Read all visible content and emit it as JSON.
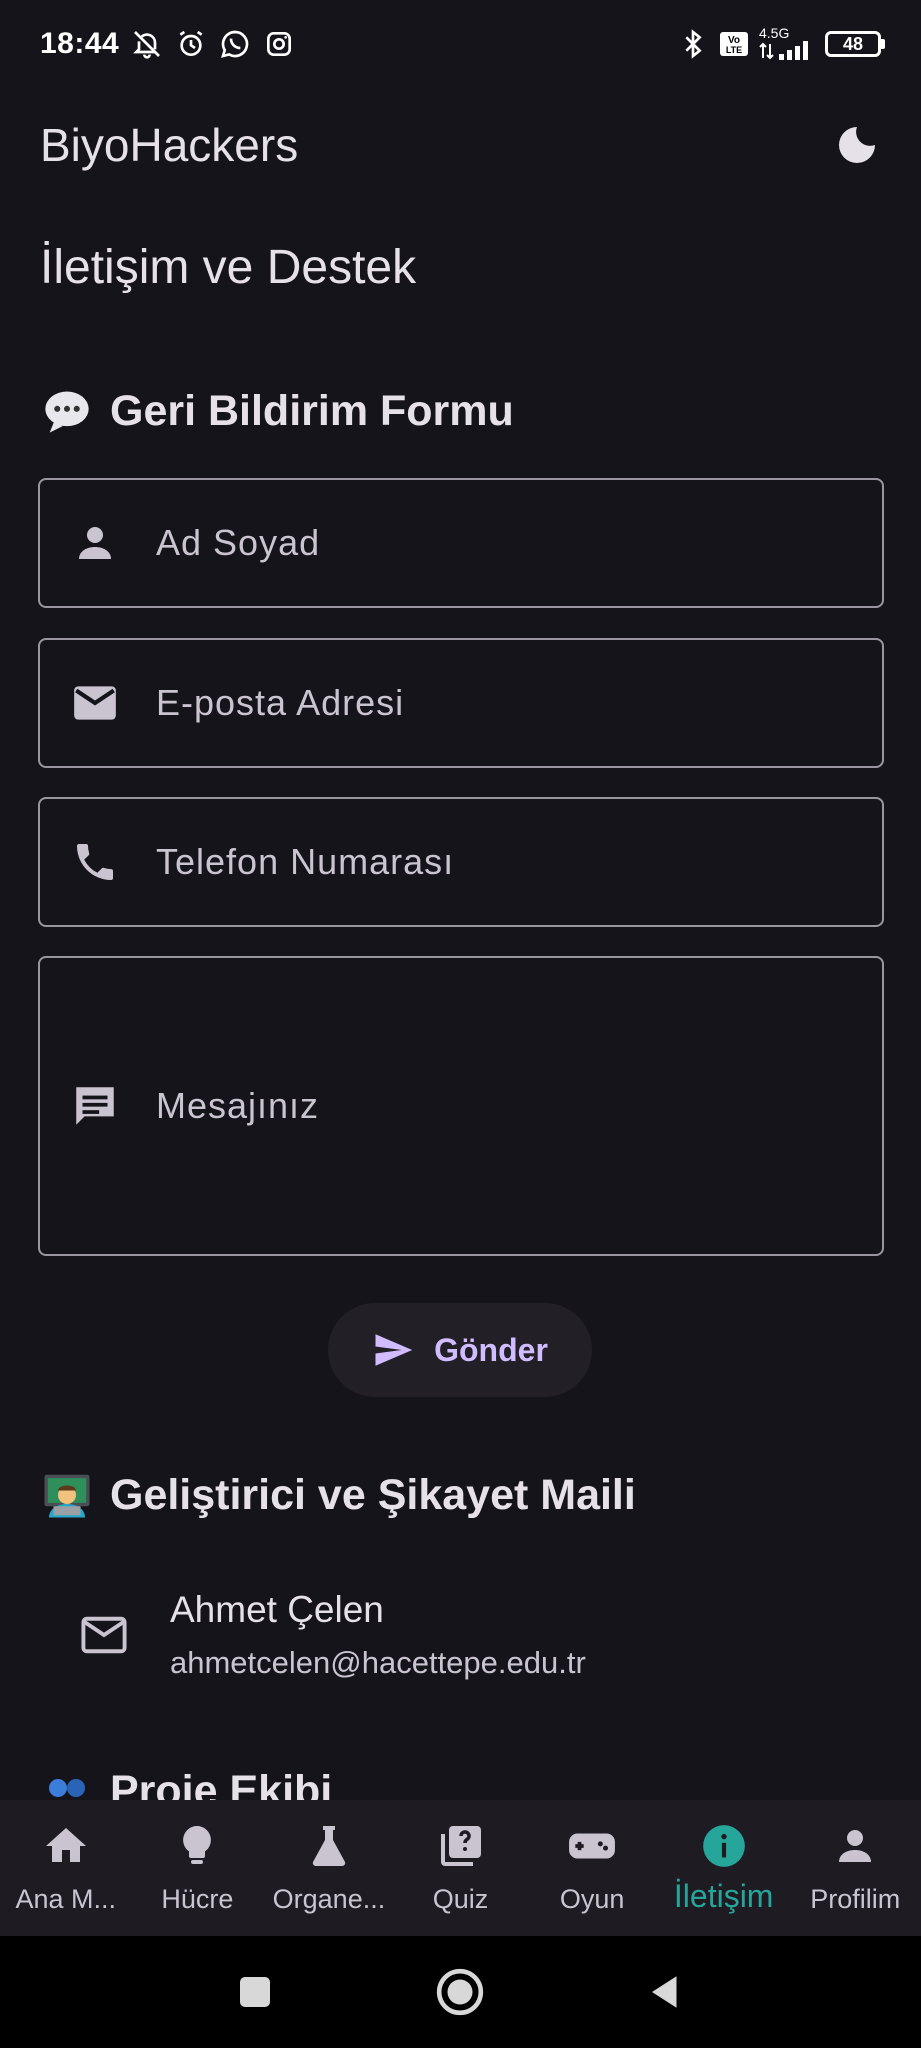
{
  "status_bar": {
    "time": "18:44",
    "network": "4.5G",
    "volte": "Vo LTE",
    "battery": "48"
  },
  "app_bar": {
    "title": "BiyoHackers"
  },
  "page": {
    "title": "İletişim ve Destek"
  },
  "feedback": {
    "heading": "Geri Bildirim Formu",
    "fields": {
      "name_placeholder": "Ad Soyad",
      "email_placeholder": "E-posta Adresi",
      "phone_placeholder": "Telefon Numarası",
      "message_placeholder": "Mesajınız"
    },
    "send_label": "Gönder"
  },
  "developer": {
    "heading": "Geliştirici ve Şikayet Maili",
    "name": "Ahmet Çelen",
    "email": "ahmetcelen@hacettepe.edu.tr"
  },
  "team": {
    "heading": "Proje Ekibi"
  },
  "bottom_nav": {
    "items": [
      {
        "label": "Ana M...",
        "icon": "home-icon"
      },
      {
        "label": "Hücre",
        "icon": "lightbulb-icon"
      },
      {
        "label": "Organe...",
        "icon": "flask-icon"
      },
      {
        "label": "Quiz",
        "icon": "quiz-icon"
      },
      {
        "label": "Oyun",
        "icon": "gamepad-icon"
      },
      {
        "label": "İletişim",
        "icon": "info-icon"
      },
      {
        "label": "Profilim",
        "icon": "person-icon"
      }
    ],
    "active_index": 5
  },
  "colors": {
    "background": "#16141b",
    "accent": "#d0bcff",
    "active_nav": "#26a69a"
  }
}
